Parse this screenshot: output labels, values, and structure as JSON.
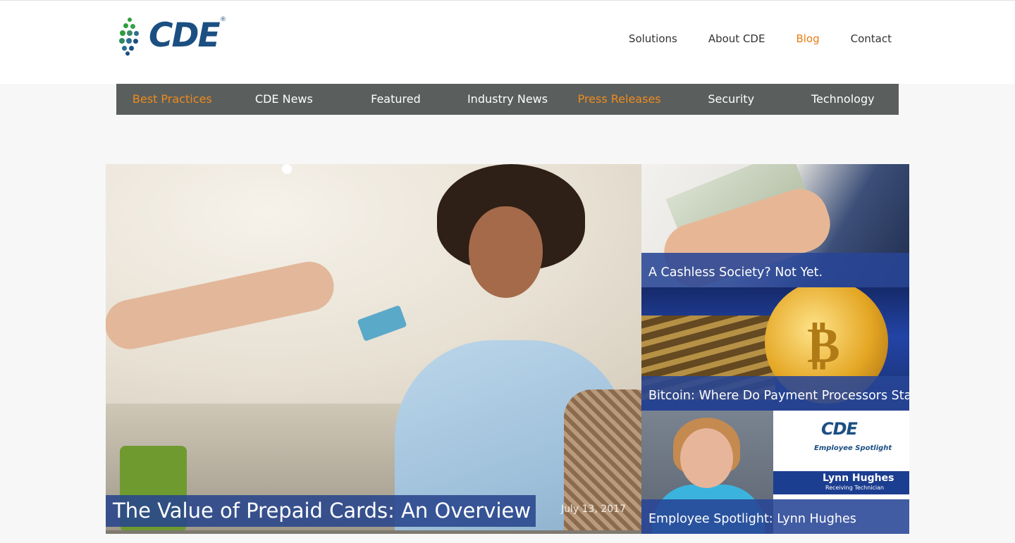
{
  "header": {
    "logo_text": "CDE",
    "nav": [
      {
        "label": "Solutions",
        "active": false
      },
      {
        "label": "About CDE",
        "active": false
      },
      {
        "label": "Blog",
        "active": true
      },
      {
        "label": "Contact",
        "active": false
      }
    ]
  },
  "categories": [
    {
      "label": "Best Practices",
      "highlighted": true
    },
    {
      "label": "CDE News",
      "highlighted": false
    },
    {
      "label": "Featured",
      "highlighted": false
    },
    {
      "label": "Industry News",
      "highlighted": false
    },
    {
      "label": "Press Releases",
      "highlighted": true
    },
    {
      "label": "Security",
      "highlighted": false
    },
    {
      "label": "Technology",
      "highlighted": false
    }
  ],
  "featured": {
    "title": "The Value of Prepaid Cards: An Overview",
    "date": "July 13, 2017"
  },
  "side_posts": [
    {
      "title": "A Cashless Society? Not Yet."
    },
    {
      "title": "Bitcoin: Where Do Payment Processors Stand?"
    },
    {
      "title": "Employee Spotlight: Lynn Hughes",
      "image_text": {
        "logo": "CDE",
        "heading": "Employee Spotlight",
        "name": "Lynn Hughes",
        "role": "Receiving Technician"
      }
    }
  ],
  "colors": {
    "accent": "#e87d12",
    "category_bar": "#5a5f5d",
    "caption_bg": "#284696",
    "brand_blue": "#1b4f82",
    "brand_green": "#2e9e3d"
  }
}
